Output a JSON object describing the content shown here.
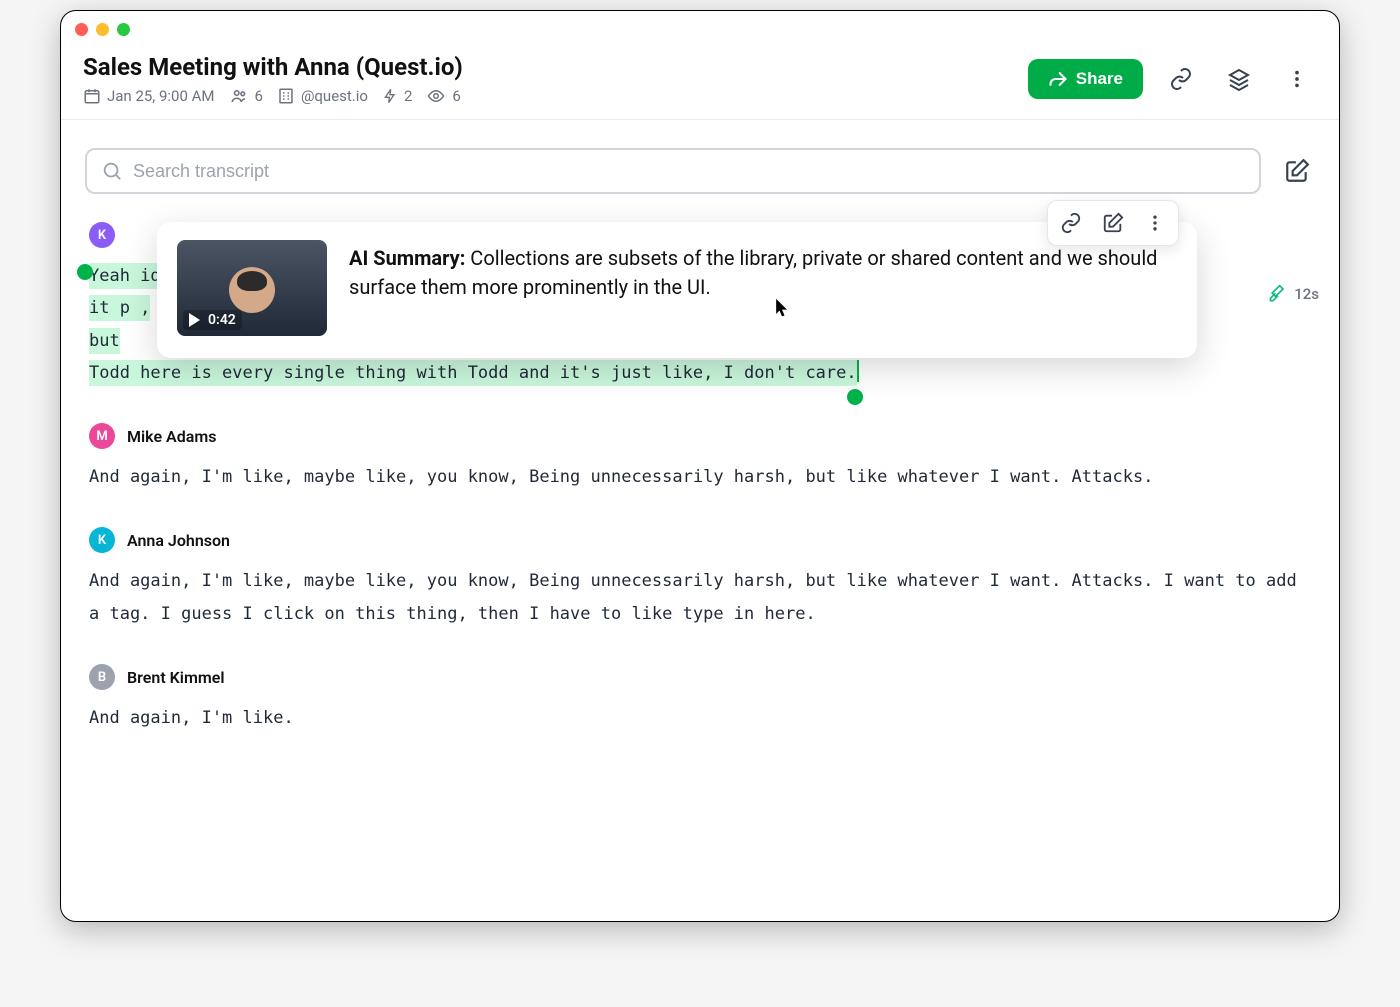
{
  "header": {
    "title": "Sales Meeting with Anna (Quest.io)",
    "date": "Jan 25, 9:00 AM",
    "attendees": "6",
    "domain": "@quest.io",
    "flash_count": "2",
    "views": "6",
    "share_label": "Share"
  },
  "search": {
    "placeholder": "Search transcript"
  },
  "highlight_pill": {
    "duration": "12s"
  },
  "popover": {
    "thumb_time": "0:42",
    "summary_label": "AI Summary:",
    "summary_text": "Collections are subsets of the library, private or shared content and we should surface them more prominently in the UI."
  },
  "entries": [
    {
      "avatar_letter": "K",
      "avatar_class": "av-purple",
      "name": "",
      "highlighted": true,
      "lines": [
        "Yeah                                                                                                            id",
        "it p                                                                                                             ,",
        "but",
        "Todd here is every single thing with Todd and it's just like, I don't care."
      ]
    },
    {
      "avatar_letter": "M",
      "avatar_class": "av-pink",
      "name": "Mike Adams",
      "highlighted": false,
      "text": "And again, I'm like, maybe like, you know, Being unnecessarily harsh, but like whatever I want. Attacks."
    },
    {
      "avatar_letter": "K",
      "avatar_class": "av-cyan",
      "name": "Anna Johnson",
      "highlighted": false,
      "text": "And again, I'm like, maybe like, you know, Being unnecessarily harsh, but like whatever I want. Attacks. I want to add a tag. I guess I click on this thing, then I have to like type in here."
    },
    {
      "avatar_letter": "B",
      "avatar_class": "av-gray",
      "name": "Brent Kimmel",
      "highlighted": false,
      "text": "And again, I'm like."
    }
  ]
}
